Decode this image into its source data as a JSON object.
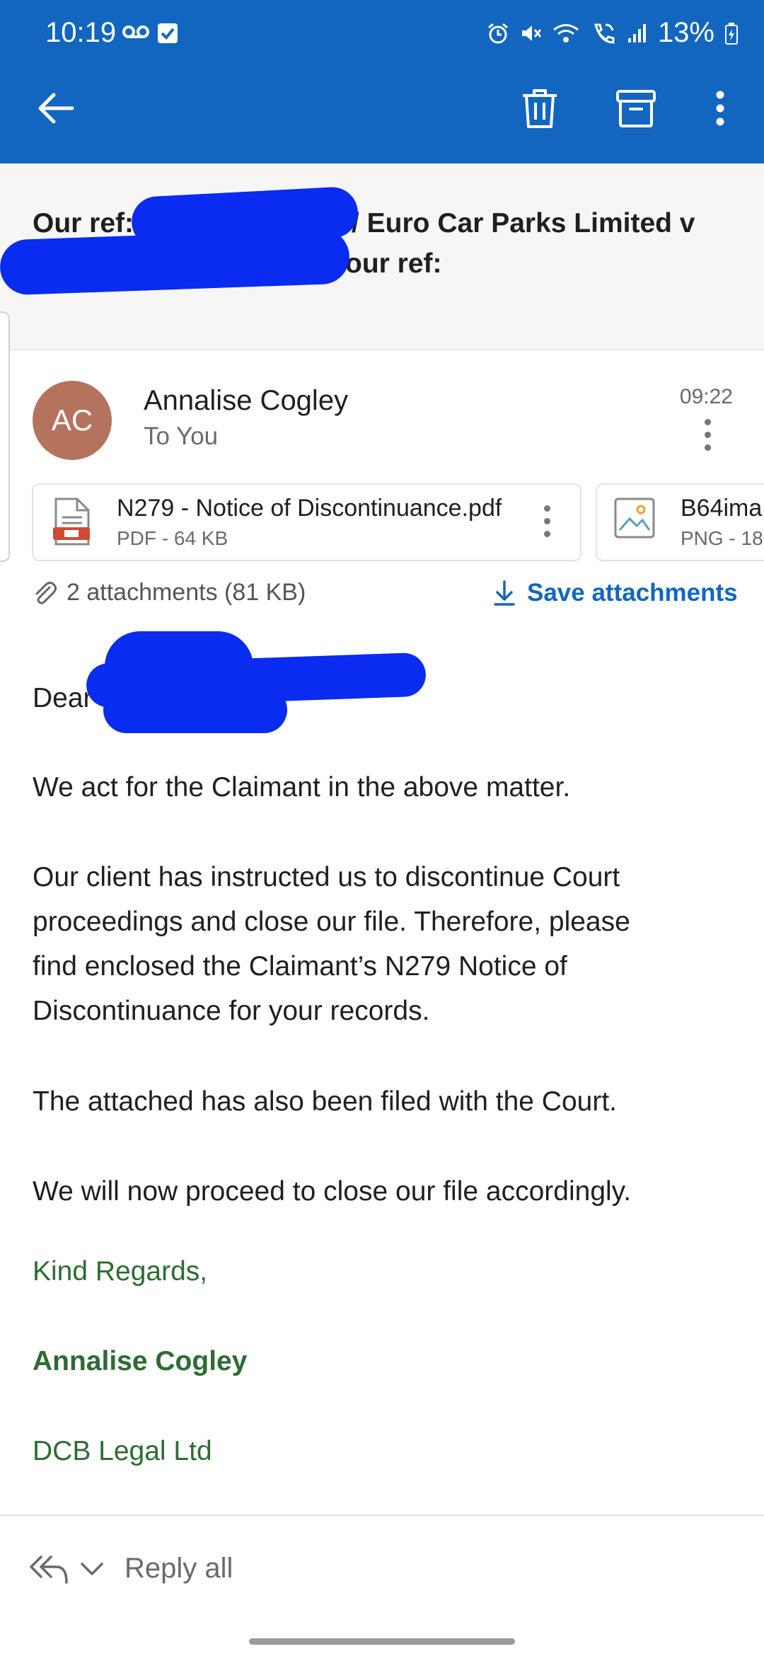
{
  "status_bar": {
    "time": "10:19",
    "battery": "13%"
  },
  "colors": {
    "appbar": "#1266bf",
    "accent": "#1266bf",
    "signature": "#2e6b33",
    "avatar": "#b5735e",
    "redaction": "#0a2cf0"
  },
  "toolbar": {
    "icons": [
      "back-arrow-icon",
      "trash-icon",
      "archive-icon",
      "more-vertical-icon"
    ]
  },
  "subject": {
    "line1_prefix": "Our ref:",
    "line1_suffix": "/ Euro Car Parks Limited v",
    "line2_suffix": "our ref:"
  },
  "message": {
    "avatar_initials": "AC",
    "sender": "Annalise Cogley",
    "recipient": "To You",
    "time": "09:22"
  },
  "attachments": {
    "items": [
      {
        "name": "N279 - Notice of Discontinuance.pdf",
        "meta": "PDF - 64 KB",
        "icon": "pdf-file-icon"
      },
      {
        "name": "B64ima",
        "meta": "PNG - 18",
        "icon": "image-file-icon"
      }
    ],
    "summary": "2 attachments (81 KB)",
    "save_label": "Save attachments"
  },
  "body": {
    "greeting": "Dear",
    "p1": "We act for the Claimant in the above matter.",
    "p2_lines": [
      "Our client has instructed us to discontinue Court",
      "proceedings and close our file. Therefore, please",
      "find enclosed the Claimant’s N279 Notice of",
      "Discontinuance for your records."
    ],
    "p3": "The attached has also been filed with the Court.",
    "p4": "We will now proceed to close our file accordingly."
  },
  "signature": {
    "closing": "Kind Regards,",
    "name": "Annalise Cogley",
    "company": "DCB Legal Ltd"
  },
  "footer": {
    "reply_label": "Reply all"
  }
}
